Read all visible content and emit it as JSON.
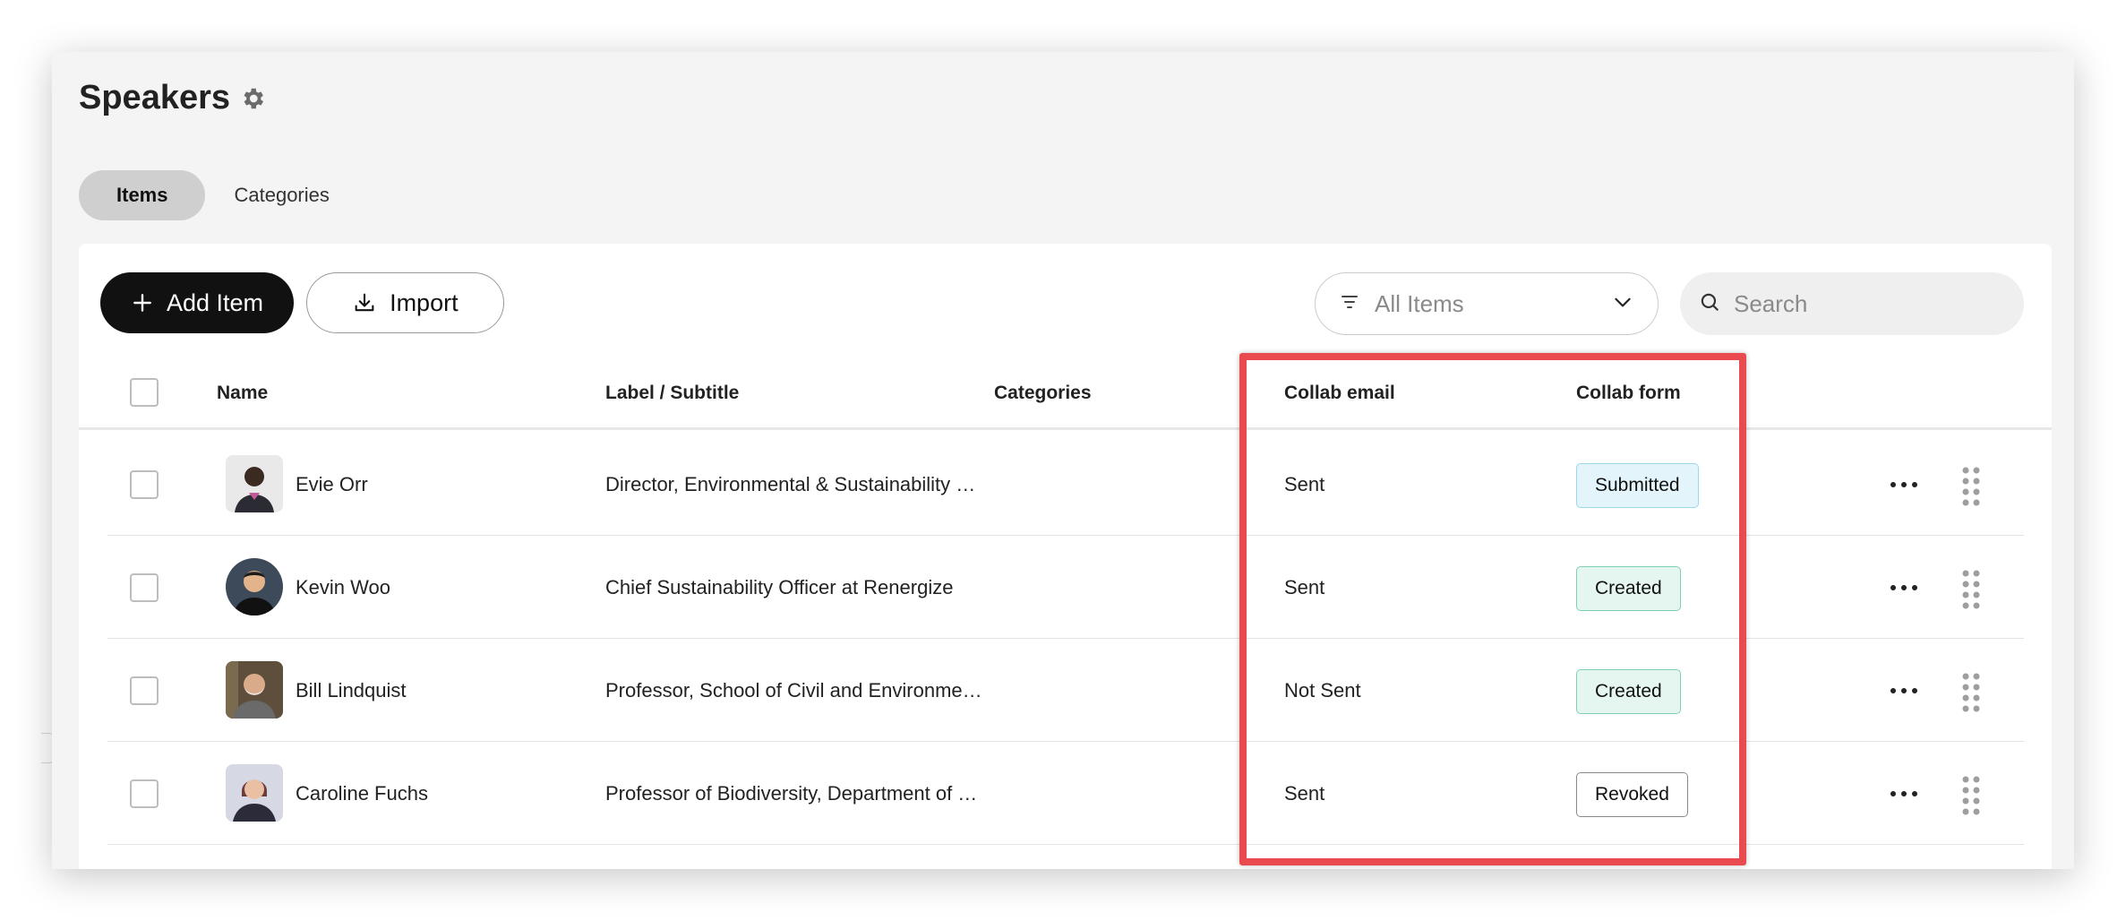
{
  "page": {
    "title": "Speakers",
    "settings_icon": "gear-icon"
  },
  "tabs": [
    {
      "label": "Items",
      "active": true
    },
    {
      "label": "Categories",
      "active": false
    }
  ],
  "toolbar": {
    "add_label": "Add Item",
    "add_icon": "plus-icon",
    "import_label": "Import",
    "import_icon": "download-icon",
    "filter_label": "All Items",
    "filter_icons": [
      "filter-lines-icon",
      "chevron-down-icon"
    ],
    "search_placeholder": "Search",
    "search_icon": "search-icon"
  },
  "table": {
    "columns": [
      "Name",
      "Label / Subtitle",
      "Categories",
      "Collab email",
      "Collab form"
    ],
    "rows": [
      {
        "name": "Evie Orr",
        "subtitle": "Director, Environmental & Sustainability …",
        "categories": "",
        "collab_email": "Sent",
        "collab_form": "Submitted",
        "form_status": "submitted"
      },
      {
        "name": "Kevin Woo",
        "subtitle": "Chief Sustainability Officer at Renergize",
        "categories": "",
        "collab_email": "Sent",
        "collab_form": "Created",
        "form_status": "created"
      },
      {
        "name": "Bill Lindquist",
        "subtitle": "Professor, School of Civil and Environme…",
        "categories": "",
        "collab_email": "Not Sent",
        "collab_form": "Created",
        "form_status": "created"
      },
      {
        "name": "Caroline Fuchs",
        "subtitle": "Professor of Biodiversity, Department of …",
        "categories": "",
        "collab_email": "Sent",
        "collab_form": "Revoked",
        "form_status": "revoked"
      }
    ],
    "row_icons": [
      "more-horizontal-icon",
      "drag-handle-icon"
    ]
  },
  "colors": {
    "highlight_border": "#e84a4f",
    "submitted_bg": "#e3f5fb",
    "created_bg": "#e4f6ef",
    "primary_button": "#111111"
  }
}
